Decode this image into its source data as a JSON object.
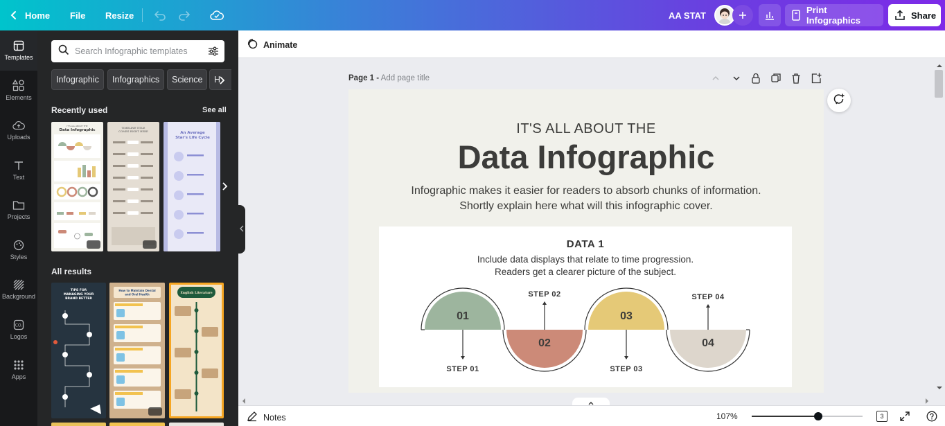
{
  "topbar": {
    "home_label": "Home",
    "file_label": "File",
    "resize_label": "Resize",
    "project_name": "AA STAT",
    "print_label": "Print Infographics",
    "share_label": "Share"
  },
  "rail": {
    "items": [
      {
        "label": "Templates",
        "icon": "templates-icon"
      },
      {
        "label": "Elements",
        "icon": "elements-icon"
      },
      {
        "label": "Uploads",
        "icon": "uploads-icon"
      },
      {
        "label": "Text",
        "icon": "text-icon"
      },
      {
        "label": "Projects",
        "icon": "projects-icon"
      },
      {
        "label": "Styles",
        "icon": "styles-icon"
      },
      {
        "label": "Background",
        "icon": "background-icon"
      },
      {
        "label": "Logos",
        "icon": "logos-icon"
      },
      {
        "label": "Apps",
        "icon": "apps-icon"
      }
    ]
  },
  "panel": {
    "search_placeholder": "Search Infographic templates",
    "chips": [
      "Infographic",
      "Infographics",
      "Science",
      "H"
    ],
    "recent_title": "Recently used",
    "see_all": "See all",
    "all_results_title": "All results",
    "recent_thumbs": [
      {
        "title": "Data Infographic",
        "subtitle": "IT'S ALL ABOUT THE"
      },
      {
        "title": "TIMELINE TITLE COMES RIGHT HERE",
        "subtitle": ""
      },
      {
        "title": "An Average Star's Life Cycle",
        "subtitle": ""
      }
    ],
    "result_thumbs": [
      {
        "title": "TIPS FOR MANAGING YOUR BRAND BETTER"
      },
      {
        "title": "How to Maintain Dental and Oral Health"
      },
      {
        "title": "English Literature"
      }
    ]
  },
  "editor": {
    "animate_label": "Animate",
    "page_label": "Page 1 -",
    "page_title_placeholder": "Add page title"
  },
  "design": {
    "kicker": "IT'S ALL ABOUT THE",
    "title": "Data Infographic",
    "subtitle_line1": "Infographic makes it easier for readers to absorb chunks of information.",
    "subtitle_line2": "Shortly explain here what will this infographic cover.",
    "card_heading": "DATA 1",
    "card_desc_line1": "Include data displays that relate to time progression.",
    "card_desc_line2": "Readers get a clearer picture of the subject.",
    "steps": [
      {
        "num": "01",
        "label": "STEP 01",
        "color": "#9db59e"
      },
      {
        "num": "02",
        "label": "STEP 02",
        "color": "#cc8a78"
      },
      {
        "num": "03",
        "label": "STEP 03",
        "color": "#e5c977"
      },
      {
        "num": "04",
        "label": "STEP 04",
        "color": "#ddd6cc"
      }
    ]
  },
  "bottombar": {
    "notes_label": "Notes",
    "zoom": "107%",
    "zoom_fraction": 0.6,
    "page_count": "3"
  }
}
